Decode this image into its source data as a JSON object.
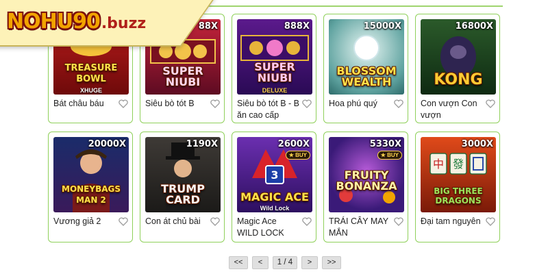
{
  "brand": {
    "logo_main": "NOHU90",
    "logo_suffix": ".buzz"
  },
  "games": [
    {
      "name": "Bát châu báu",
      "thumb_title": "TREASURE BOWL",
      "thumb_sub": "XHUGE",
      "multiplier": "",
      "buy": false
    },
    {
      "name": "Siêu bò tót B",
      "thumb_title": "SUPER NIUBI",
      "thumb_sub": "",
      "multiplier": "88X",
      "buy": false
    },
    {
      "name": "Siêu bò tót B - B ăn cao cấp",
      "thumb_title": "SUPER NIUBI",
      "thumb_sub": "DELUXE",
      "multiplier": "888X",
      "buy": false
    },
    {
      "name": "Hoa phú quý",
      "thumb_title": "BLOSSOM WEALTH",
      "thumb_sub": "",
      "multiplier": "15000X",
      "buy": false
    },
    {
      "name": "Con vượn Con vượn",
      "thumb_title": "KONG",
      "thumb_sub": "",
      "multiplier": "16800X",
      "buy": false
    },
    {
      "name": "Vương giả 2",
      "thumb_title": "MONEYBAGS MAN 2",
      "thumb_sub": "",
      "multiplier": "20000X",
      "buy": false
    },
    {
      "name": "Con át chủ bài",
      "thumb_title": "TRUMP CARD",
      "thumb_sub": "",
      "multiplier": "1190X",
      "buy": false
    },
    {
      "name": "Magic Ace WILD LOCK",
      "thumb_title": "MAGIC ACE",
      "thumb_sub": "Wild Lock",
      "multiplier": "2600X",
      "buy": true
    },
    {
      "name": "TRÁI CÂY MAY MẮN",
      "thumb_title": "FRUITY BONANZA",
      "thumb_sub": "",
      "multiplier": "5330X",
      "buy": true
    },
    {
      "name": "Đại tam nguyên",
      "thumb_title": "BIG THREE DRAGONS",
      "thumb_sub": "",
      "multiplier": "3000X",
      "buy": false
    }
  ],
  "pagination": {
    "first": "<<",
    "prev": "<",
    "info": "1 / 4",
    "next": ">",
    "last": ">>"
  },
  "colors": {
    "accent": "#8fd05a",
    "brand_gold": "#f2a400",
    "brand_red": "#b0201a"
  }
}
